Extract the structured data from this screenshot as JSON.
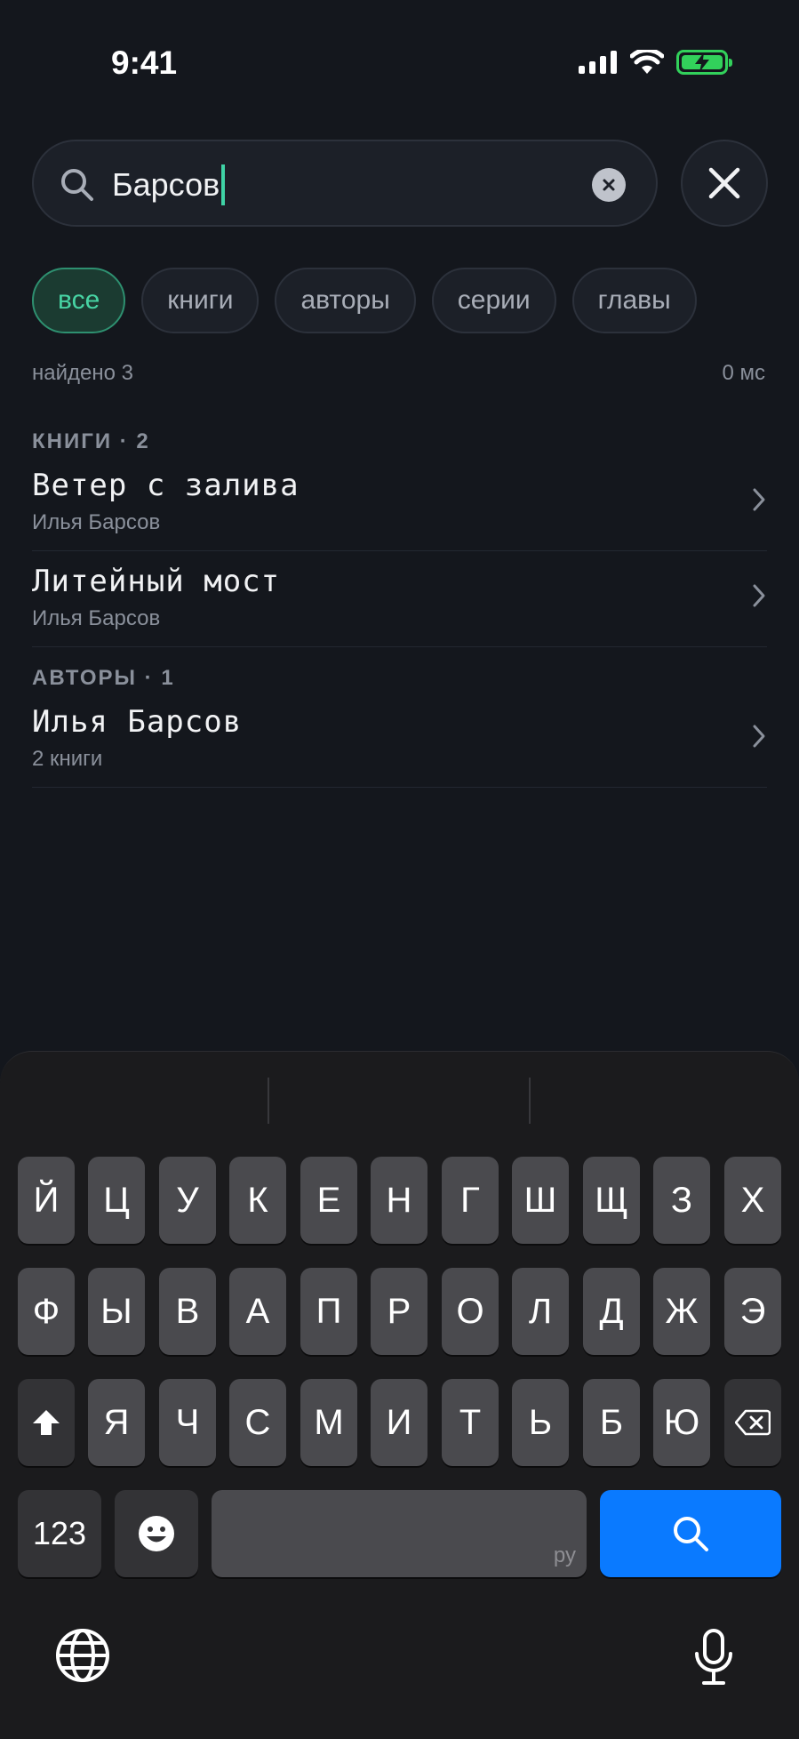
{
  "status": {
    "time": "9:41"
  },
  "search": {
    "query": "Барсов"
  },
  "filters": [
    {
      "label": "все",
      "active": true
    },
    {
      "label": "книги",
      "active": false
    },
    {
      "label": "авторы",
      "active": false
    },
    {
      "label": "серии",
      "active": false
    },
    {
      "label": "главы",
      "active": false
    }
  ],
  "summary": {
    "found": "найдено 3",
    "elapsed": "0 мс"
  },
  "sections": {
    "books": {
      "header": "КНИГИ · 2",
      "items": [
        {
          "title": "Ветер с залива",
          "subtitle": "Илья Барсов"
        },
        {
          "title": "Литейный мост",
          "subtitle": "Илья Барсов"
        }
      ]
    },
    "authors": {
      "header": "АВТОРЫ · 1",
      "items": [
        {
          "title": "Илья Барсов",
          "subtitle": "2 книги"
        }
      ]
    }
  },
  "keyboard": {
    "row1": [
      "Й",
      "Ц",
      "У",
      "К",
      "Е",
      "Н",
      "Г",
      "Ш",
      "Щ",
      "З",
      "Х"
    ],
    "row2": [
      "Ф",
      "Ы",
      "В",
      "А",
      "П",
      "Р",
      "О",
      "Л",
      "Д",
      "Ж",
      "Э"
    ],
    "row3": [
      "Я",
      "Ч",
      "С",
      "М",
      "И",
      "Т",
      "Ь",
      "Б",
      "Ю"
    ],
    "numbers_key": "123",
    "space_language": "ру",
    "icons": [
      "shift-icon",
      "delete-icon",
      "emoji-icon",
      "search-icon",
      "globe-icon",
      "microphone-icon"
    ]
  },
  "colors": {
    "accent": "#47d3a3",
    "background": "#14171d",
    "key_blue": "#0a7aff",
    "battery": "#32d15b"
  }
}
